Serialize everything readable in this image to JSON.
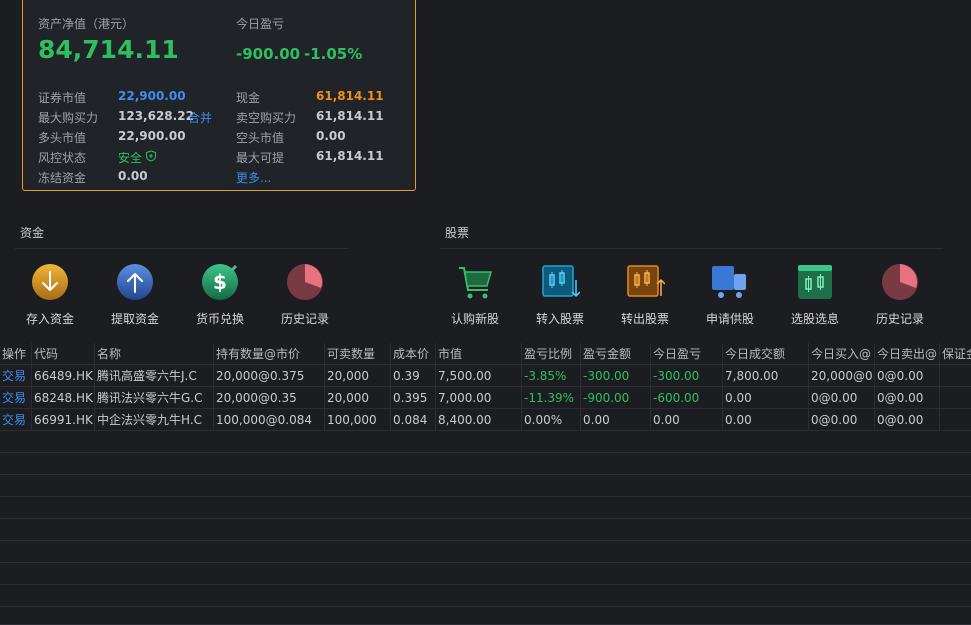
{
  "summary": {
    "net_label": "资产净值（港元）",
    "net_value": "84,714.11",
    "pnl_label": "今日盈亏",
    "pnl_value": "-900.00",
    "pnl_pct": "-1.05%",
    "left": [
      {
        "label": "证券市值",
        "value": "22,900.00"
      },
      {
        "label": "最大购买力",
        "value": "123,628.22"
      },
      {
        "label": "多头市值",
        "value": "22,900.00"
      },
      {
        "label": "风控状态",
        "value": "安全"
      },
      {
        "label": "冻结资金",
        "value": "0.00"
      }
    ],
    "merge_label": "合并",
    "right": [
      {
        "label": "现金",
        "value": "61,814.11"
      },
      {
        "label": "卖空购买力",
        "value": "61,814.11"
      },
      {
        "label": "空头市值",
        "value": "0.00"
      },
      {
        "label": "最大可提",
        "value": "61,814.11"
      }
    ],
    "more_label": "更多..."
  },
  "funds": {
    "title": "资金",
    "actions": [
      {
        "label": "存入资金",
        "icon": "deposit-icon"
      },
      {
        "label": "提取资金",
        "icon": "withdraw-icon"
      },
      {
        "label": "货币兑换",
        "icon": "currency-exchange-icon"
      },
      {
        "label": "历史记录",
        "icon": "history-icon"
      }
    ]
  },
  "stocks": {
    "title": "股票",
    "actions": [
      {
        "label": "认购新股",
        "icon": "cart-icon"
      },
      {
        "label": "转入股票",
        "icon": "transfer-in-icon"
      },
      {
        "label": "转出股票",
        "icon": "transfer-out-icon"
      },
      {
        "label": "申请供股",
        "icon": "truck-icon"
      },
      {
        "label": "选股选息",
        "icon": "dividend-select-icon"
      },
      {
        "label": "历史记录",
        "icon": "history-icon"
      }
    ]
  },
  "table": {
    "headers": [
      "操作",
      "代码",
      "名称",
      "持有数量@市价",
      "可卖数量",
      "成本价",
      "市值",
      "盈亏比例",
      "盈亏金额",
      "今日盈亏",
      "今日成交额",
      "今日买入@",
      "今日卖出@",
      "保证金"
    ],
    "rows": [
      [
        "交易",
        "66489.HK",
        "腾讯高盛零六牛J.C",
        "20,000@0.375",
        "20,000",
        "0.39",
        "7,500.00",
        "-3.85%",
        "-300.00",
        "-300.00",
        "7,800.00",
        "20,000@0.",
        "0@0.00",
        ""
      ],
      [
        "交易",
        "68248.HK",
        "腾讯法兴零六牛G.C",
        "20,000@0.35",
        "20,000",
        "0.395",
        "7,000.00",
        "-11.39%",
        "-900.00",
        "-600.00",
        "0.00",
        "0@0.00",
        "0@0.00",
        ""
      ],
      [
        "交易",
        "66991.HK",
        "中企法兴零九牛H.C",
        "100,000@0.084",
        "100,000",
        "0.084",
        "8,400.00",
        "0.00%",
        "0.00",
        "0.00",
        "0.00",
        "0@0.00",
        "0@0.00",
        ""
      ]
    ]
  },
  "colors": {
    "accent_border": "#e39b2a",
    "positive_green": "#2ec060",
    "link_blue": "#3d8ef0",
    "cash_orange": "#f0901e"
  }
}
